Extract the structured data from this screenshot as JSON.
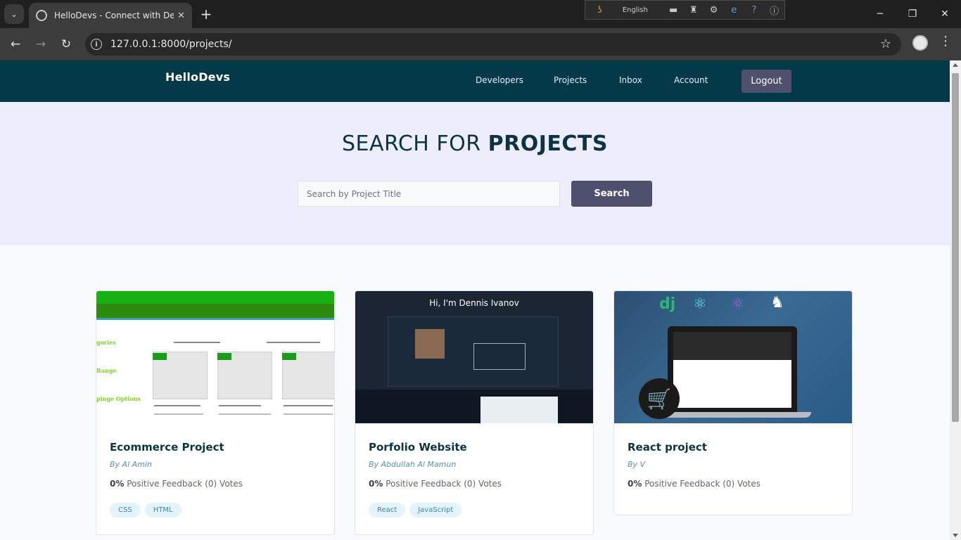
{
  "browser": {
    "tab_title": "HelloDevs - Connect with Devel",
    "url": "127.0.0.1:8000/projects/",
    "extension_language": "English"
  },
  "site": {
    "logo": "HelloDevs",
    "nav": [
      "Developers",
      "Projects",
      "Inbox",
      "Account"
    ],
    "logout_label": "Logout"
  },
  "hero": {
    "title_prefix": "SEARCH FOR ",
    "title_bold": "PROJECTS",
    "search_placeholder": "Search by Project Title",
    "search_value": "",
    "search_button": "Search"
  },
  "projects": [
    {
      "title": "Ecommerce Project",
      "author": "By Al Amin",
      "feedback_percent": "0%",
      "feedback_text": " Positive Feedback (0) Votes",
      "tags": [
        "CSS",
        "HTML"
      ]
    },
    {
      "title": "Porfolio Website",
      "author": "By Abdullah Al Mamun",
      "feedback_percent": "0%",
      "feedback_text": " Positive Feedback (0) Votes",
      "tags": [
        "React",
        "JavaScript"
      ]
    },
    {
      "title": "React project",
      "author": "By V",
      "feedback_percent": "0%",
      "feedback_text": " Positive Feedback (0) Votes",
      "tags": []
    }
  ],
  "thumbnails": {
    "portfolio_heading": "Hi, I'm Dennis Ivanov",
    "react_logos": [
      "dj"
    ]
  },
  "colors": {
    "header_bg": "#04394a",
    "hero_bg": "#eeedfb",
    "button_bg": "#4f4f6e",
    "tag_bg": "#e3f4fb",
    "title_color": "#0c3442"
  },
  "icons": [
    "tab-list-icon",
    "close-icon",
    "plus-icon",
    "back-icon",
    "forward-icon",
    "reload-icon",
    "info-icon",
    "star-icon",
    "profile-icon",
    "menu-icon",
    "minimize-icon",
    "maximize-icon",
    "window-close-icon"
  ]
}
